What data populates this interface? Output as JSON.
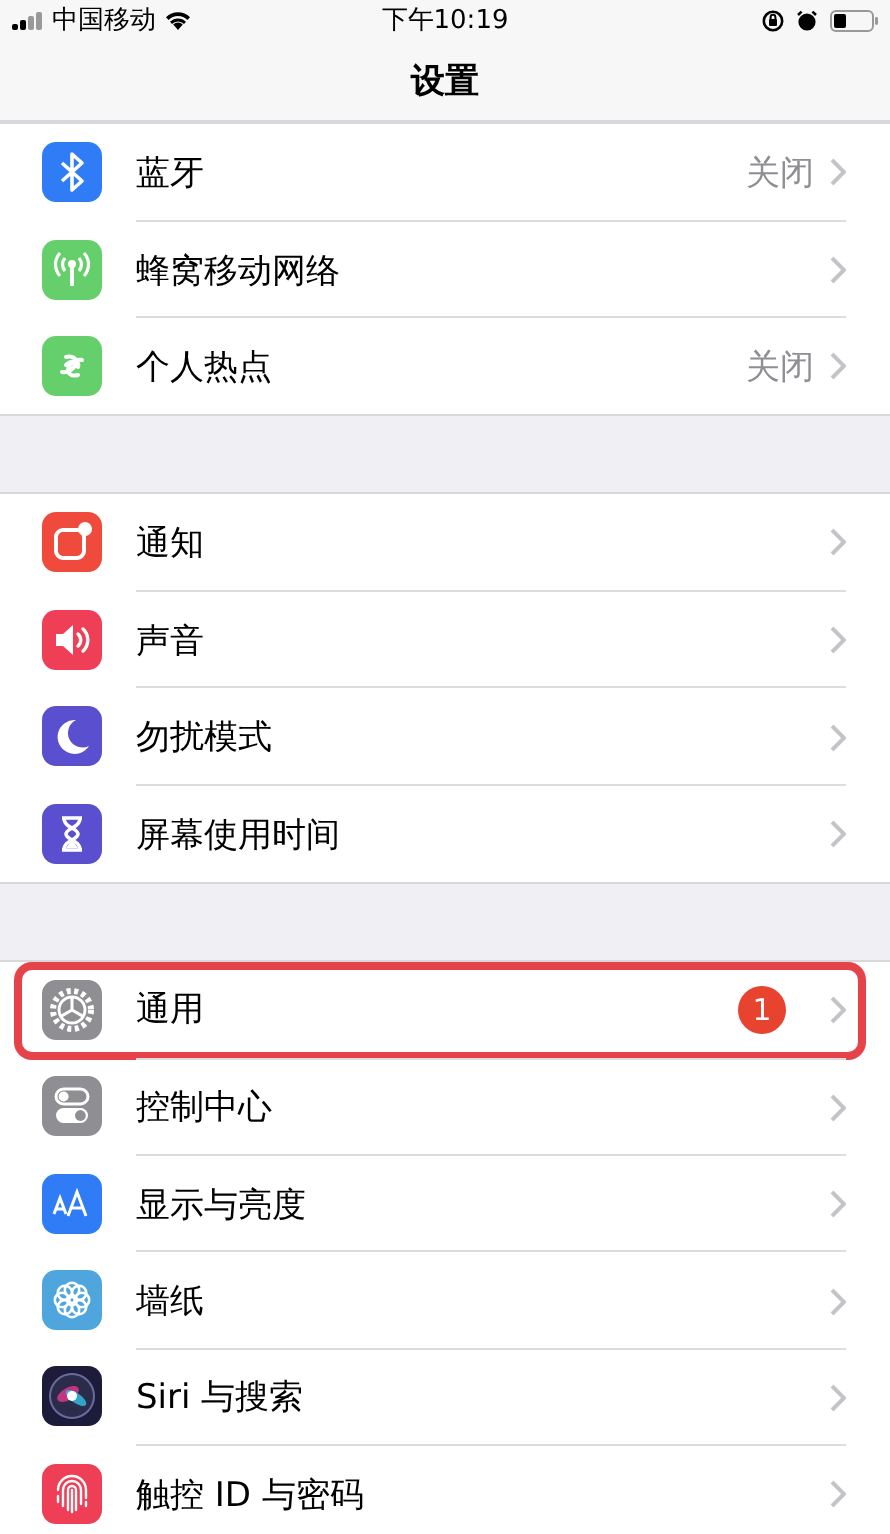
{
  "status_bar": {
    "carrier": "中国移动",
    "time": "下午10:19"
  },
  "nav_bar": {
    "title": "设置"
  },
  "groups": [
    {
      "items": [
        {
          "label": "蓝牙",
          "value": "关闭",
          "color": "#2f7cf6",
          "highlighted": false
        },
        {
          "label": "蜂窝移动网络",
          "color": "#65d06b",
          "highlighted": false
        },
        {
          "label": "个人热点",
          "value": "关闭",
          "color": "#65d06b",
          "highlighted": false
        }
      ]
    },
    {
      "items": [
        {
          "label": "通知",
          "color": "#ef4a3c",
          "highlighted": false
        },
        {
          "label": "声音",
          "color": "#ee3f57",
          "highlighted": false
        },
        {
          "label": "勿扰模式",
          "color": "#5a4fcf",
          "highlighted": false
        },
        {
          "label": "屏幕使用时间",
          "color": "#5a4fcf",
          "highlighted": false
        }
      ]
    },
    {
      "items": [
        {
          "label": "通用",
          "badge": "1",
          "color": "#8e8e93",
          "highlighted": true
        },
        {
          "label": "控制中心",
          "color": "#8e8e93",
          "highlighted": false
        },
        {
          "label": "显示与亮度",
          "color": "#2f7cf6",
          "highlighted": false
        },
        {
          "label": "墙纸",
          "color": "#4fa6dc",
          "highlighted": false
        },
        {
          "label": "Siri 与搜索",
          "color": "#1c1c3a",
          "highlighted": false
        },
        {
          "label": "触控 ID 与密码",
          "color": "#ee3f57",
          "highlighted": false
        }
      ]
    }
  ]
}
